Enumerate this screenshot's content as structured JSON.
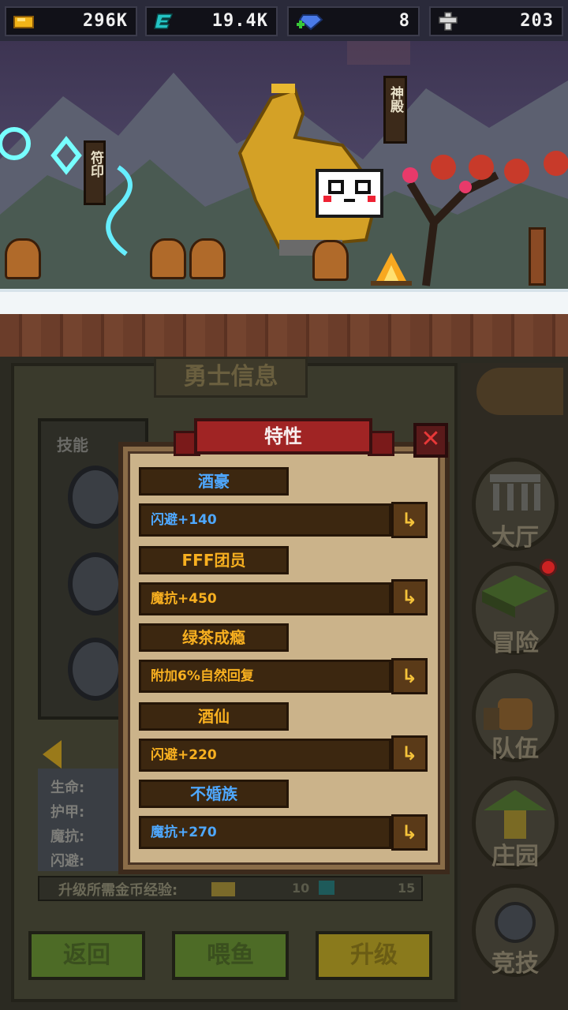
{
  "resources": [
    {
      "icon": "gold-ingot-icon",
      "value": "296K"
    },
    {
      "icon": "e-coin-icon",
      "value": "19.4K"
    },
    {
      "icon": "gem-icon",
      "value": "8"
    },
    {
      "icon": "cross-icon",
      "value": "203"
    }
  ],
  "scene": {
    "sign_left": "符印",
    "sign_right": "神殿"
  },
  "panel": {
    "title": "勇士信息",
    "skills_title": "技能",
    "stats": [
      "生命:",
      "护甲:",
      "魔抗:",
      "闪避:"
    ],
    "exp_label": "升级所需金币经验:",
    "exp_value_a": "10",
    "exp_value_b": "15"
  },
  "buttons": {
    "back": "返回",
    "feed": "喂鱼",
    "upgrade": "升级"
  },
  "nav": [
    {
      "label": "大厅",
      "icon": "hall-icon"
    },
    {
      "label": "冒险",
      "icon": "adventure-icon"
    },
    {
      "label": "队伍",
      "icon": "team-icon"
    },
    {
      "label": "庄园",
      "icon": "manor-icon"
    },
    {
      "label": "竞技",
      "icon": "arena-icon"
    }
  ],
  "modal": {
    "title": "特性",
    "close": "✕",
    "traits": [
      {
        "name": "酒豪",
        "name_color": "#4ea8ff",
        "effect": "闪避+140",
        "effect_color": "#4ea8ff"
      },
      {
        "name": "FFF团员",
        "name_color": "#f8b020",
        "effect": "魔抗+450",
        "effect_color": "#f8b020"
      },
      {
        "name": "绿茶成瘾",
        "name_color": "#f8b020",
        "effect": "附加6%自然回复",
        "effect_color": "#f8b020"
      },
      {
        "name": "酒仙",
        "name_color": "#f8b020",
        "effect": "闪避+220",
        "effect_color": "#f8b020"
      },
      {
        "name": "不婚族",
        "name_color": "#4ea8ff",
        "effect": "魔抗+270",
        "effect_color": "#4ea8ff"
      }
    ]
  }
}
